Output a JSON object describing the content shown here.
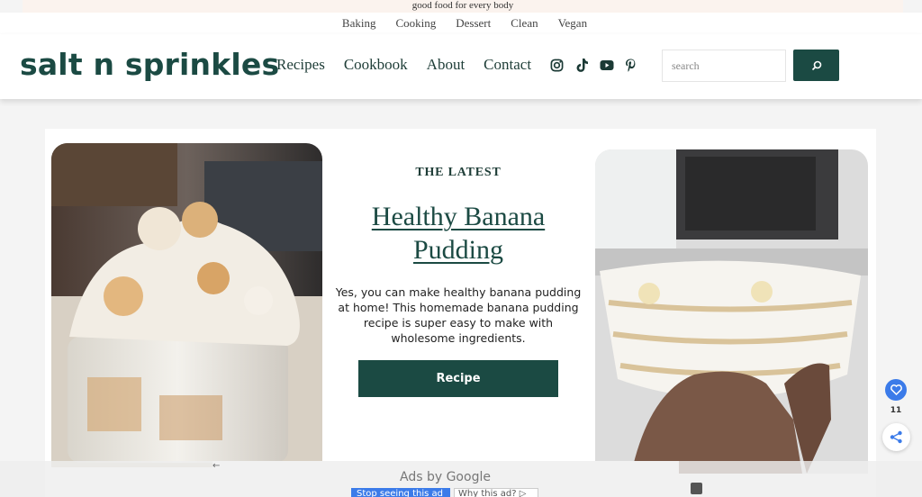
{
  "topbar": {
    "tagline": "good food for every body"
  },
  "category_nav": [
    {
      "label": "Baking"
    },
    {
      "label": "Cooking"
    },
    {
      "label": "Dessert"
    },
    {
      "label": "Clean"
    },
    {
      "label": "Vegan"
    }
  ],
  "header": {
    "logo": "salt n sprinkles",
    "nav": [
      {
        "label": "Recipes"
      },
      {
        "label": "Cookbook"
      },
      {
        "label": "About"
      },
      {
        "label": "Contact"
      }
    ],
    "social_icons": [
      "instagram-icon",
      "tiktok-icon",
      "youtube-icon",
      "pinterest-icon"
    ],
    "search": {
      "placeholder": "search",
      "value": ""
    }
  },
  "hero": {
    "eyebrow": "THE LATEST",
    "title": "Healthy Banana Pudding",
    "excerpt": "Yes, you can make healthy banana pudding at home! This homemade banana pudding recipe is super easy to make with wholesome ingredients.",
    "button_label": "Recipe"
  },
  "share": {
    "count": "11"
  },
  "ad": {
    "back_arrow": "←",
    "label": "Ads by Google",
    "stop_label": "Stop seeing this ad",
    "why_label": "Why this ad? ▷"
  },
  "colors": {
    "brand_green": "#1b4a43",
    "topbar_bg": "#fbf3ee",
    "share_blue": "#3b7be9"
  }
}
